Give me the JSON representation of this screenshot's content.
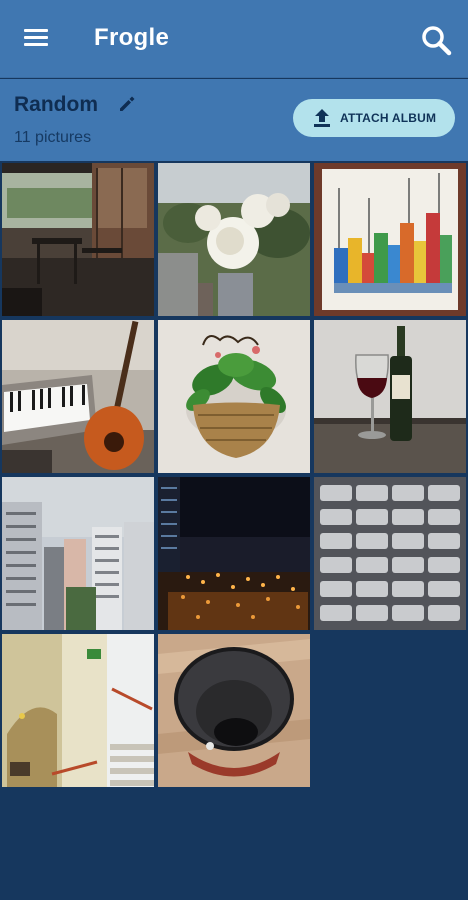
{
  "appbar": {
    "title": "Frogle",
    "menu_icon": "menu-icon",
    "search_icon": "search-icon"
  },
  "album": {
    "name": "Random",
    "count_label": "11 pictures",
    "edit_icon": "pencil-icon",
    "attach_label": "ATTACH ALBUM",
    "attach_icon": "upload-icon"
  },
  "photos": [
    {
      "subject": "restaurant-terrace"
    },
    {
      "subject": "white-roses"
    },
    {
      "subject": "colorful-houses-painting"
    },
    {
      "subject": "keyboard-and-guitar"
    },
    {
      "subject": "plant-in-wall-basket"
    },
    {
      "subject": "wine-glass-and-bottle"
    },
    {
      "subject": "city-buildings"
    },
    {
      "subject": "city-at-night"
    },
    {
      "subject": "intercom-keypad"
    },
    {
      "subject": "stairwell"
    },
    {
      "subject": "black-cup"
    }
  ],
  "colors": {
    "appbar": "#4077b1",
    "background": "#16375e",
    "attach_button": "#b3e2ec",
    "album_name": "#0f2d52"
  }
}
